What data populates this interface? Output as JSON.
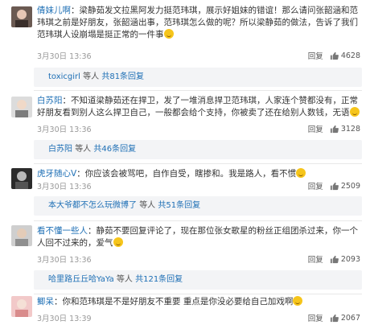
{
  "comments": [
    {
      "username": "倩妹儿啊",
      "text": "：梁静茹发文拉黑阿发力挺范玮琪，展示好姐妹的错谊！那么请问张韶涵和范玮琪之前是好朋友，张韶涵出事，范玮琪怎么做的呢？所以梁静茹的做法，告诉了我们范玮琪人设崩塌是挺正常的一件事",
      "time": "3月30日 13:36",
      "reply": "回复",
      "likes": "4628",
      "sub": {
        "name": "toxicgirl",
        "mid": "等人",
        "link": "共81条回复"
      }
    },
    {
      "username": "白苏阳",
      "text": "：不知道梁静茹还在捍卫，发了一堆消息捍卫范玮琪，人家连个赞都没有，正常好朋友看到别人这么捍卫自己，一般都会给个支持，你被卖了还在给别人数钱，无语",
      "time": "3月30日 13:36",
      "reply": "回复",
      "likes": "3128",
      "sub": {
        "name": "白苏阳",
        "mid": "等人",
        "link": "共46条回复"
      }
    },
    {
      "username": "虎牙随心V",
      "text": "：你应该会被骂吧，自作自受，瞎掺和。我是路人，看不惯",
      "time": "3月30日 13:36",
      "reply": "回复",
      "likes": "2509",
      "sub": {
        "name": "本大爷都不怎么玩微博了",
        "mid": "等人",
        "link": "共51条回复"
      }
    },
    {
      "username": "看不懂一些人",
      "text": "：静茹不要回复评论了，现在那位张女歌星的粉丝正组团杀过来，你一个人回不过来的，爱气",
      "time": "3月30日 13:36",
      "reply": "回复",
      "likes": "2093",
      "sub": {
        "name": "哈里路丘丘哈YaYa",
        "mid": "等人",
        "link": "共121条回复"
      }
    },
    {
      "username": "鲫呆",
      "text": "：你和范玮琪是不是好朋友不重要 重点是你没必要给自己加戏啊",
      "time": "3月30日 13:39",
      "reply": "回复",
      "likes": "2067"
    }
  ],
  "colors": {
    "link": "#1e6fb5",
    "sub_bg": "#f3f4f6",
    "meta": "#999999"
  },
  "icons": {
    "like": "thumbs-up-icon"
  }
}
